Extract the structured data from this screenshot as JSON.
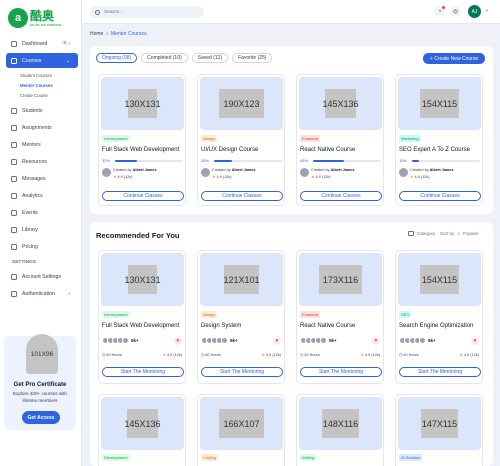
{
  "logo": {
    "badge": "a",
    "main": "酷奥",
    "sub": "ku ao educational"
  },
  "topbar": {
    "search_placeholder": "Search...",
    "avatar_initials": "AJ"
  },
  "sidebar": {
    "items": [
      {
        "label": "Dashboard",
        "count": "9"
      },
      {
        "label": "Courses"
      },
      {
        "label": "Students"
      },
      {
        "label": "Assignments"
      },
      {
        "label": "Mentors"
      },
      {
        "label": "Resources"
      },
      {
        "label": "Messages"
      },
      {
        "label": "Analytics"
      },
      {
        "label": "Events"
      },
      {
        "label": "Library"
      },
      {
        "label": "Pricing"
      }
    ],
    "sub_items": [
      "Student Courses",
      "Mentor Courses",
      "Create Course"
    ],
    "section_label": "SETTINGS",
    "settings_items": [
      {
        "label": "Account Settings"
      },
      {
        "label": "Authentication"
      }
    ]
  },
  "promo": {
    "image_label": "101X96",
    "title": "Get Pro Certificate",
    "desc": "Explore 400+ courses with lifetime members",
    "button": "Get Access"
  },
  "breadcrumb": {
    "home": "Home",
    "sep": "›",
    "current": "Mentor Courses"
  },
  "courses": {
    "tabs": [
      "Ongoing (08)",
      "Completed (10)",
      "Saved (12)",
      "Favorite (25)"
    ],
    "create_label": "+ Create New Course",
    "creator_prefix": "Created by",
    "cards": [
      {
        "thumb": "130X131",
        "badge": "Development",
        "badge_color": "#16a34a",
        "badge_bg": "#dcfce7",
        "title": "Full Stack Web Development",
        "progress": 0.32,
        "progress_label": "32%",
        "creator": "Albert James",
        "rating": "4.9 (12k)",
        "button": "Continue Classes"
      },
      {
        "thumb": "190X123",
        "badge": "Design",
        "badge_color": "#ea580c",
        "badge_bg": "#ffedd5",
        "title": "UI/UX Design Course",
        "progress": 0.26,
        "progress_label": "26%",
        "creator": "Albert James",
        "rating": "4.9 (12k)",
        "button": "Continue Classes"
      },
      {
        "thumb": "145X136",
        "badge": "Frontend",
        "badge_color": "#dc2626",
        "badge_bg": "#fee2e2",
        "title": "React Native Course",
        "progress": 0.45,
        "progress_label": "45%",
        "creator": "Albert James",
        "rating": "4.9 (12k)",
        "button": "Continue Classes"
      },
      {
        "thumb": "154X115",
        "badge": "Marketing",
        "badge_color": "#0d9488",
        "badge_bg": "#ccfbf1",
        "title": "SEO Expert A To Z Course",
        "progress": 0.1,
        "progress_label": "10%",
        "creator": "Albert James",
        "rating": "4.9 (12k)",
        "button": "Continue Classes"
      }
    ]
  },
  "recommended": {
    "title": "Recommended For You",
    "category_label": "Category",
    "sort_label": "Sort by",
    "sort_value": "Popular",
    "cards": [
      {
        "thumb": "130X131",
        "badge": "Development",
        "badge_color": "#16a34a",
        "badge_bg": "#dcfce7",
        "title": "Full Stack Web Development",
        "students": "5k+",
        "hours": "40 Hours",
        "rating": "4.9 (12k)",
        "button": "Start The Mentoring"
      },
      {
        "thumb": "121X101",
        "badge": "Design",
        "badge_color": "#ea580c",
        "badge_bg": "#ffedd5",
        "title": "Design System",
        "students": "5k+",
        "hours": "60 Hours",
        "rating": "4.9 (12k)",
        "button": "Start The Mentoring"
      },
      {
        "thumb": "173X116",
        "badge": "Frontend",
        "badge_color": "#dc2626",
        "badge_bg": "#fee2e2",
        "title": "React Native Course",
        "students": "5k+",
        "hours": "40 Hours",
        "rating": "4.9 (12k)",
        "button": "Start The Mentoring"
      },
      {
        "thumb": "154X115",
        "badge": "SEO",
        "badge_color": "#0d9488",
        "badge_bg": "#ccfbf1",
        "title": "Search Engine Optimization",
        "students": "5k+",
        "hours": "40 Hours",
        "rating": "4.9 (12k)",
        "button": "Start The Mentoring"
      }
    ],
    "cards2": [
      {
        "thumb": "145X136",
        "badge": "Development",
        "badge_color": "#16a34a",
        "badge_bg": "#dcfce7"
      },
      {
        "thumb": "166X107",
        "badge": "Coding",
        "badge_color": "#ea580c",
        "badge_bg": "#ffedd5"
      },
      {
        "thumb": "148X116",
        "badge": "Writing",
        "badge_color": "#16a34a",
        "badge_bg": "#dcfce7"
      },
      {
        "thumb": "147X115",
        "badge": "AI Solution",
        "badge_color": "#2f63e0",
        "badge_bg": "#dbeafe"
      }
    ]
  },
  "colors": {
    "accent": "#2f63e0",
    "brand": "#16a34a",
    "background": "#eef2f8"
  }
}
